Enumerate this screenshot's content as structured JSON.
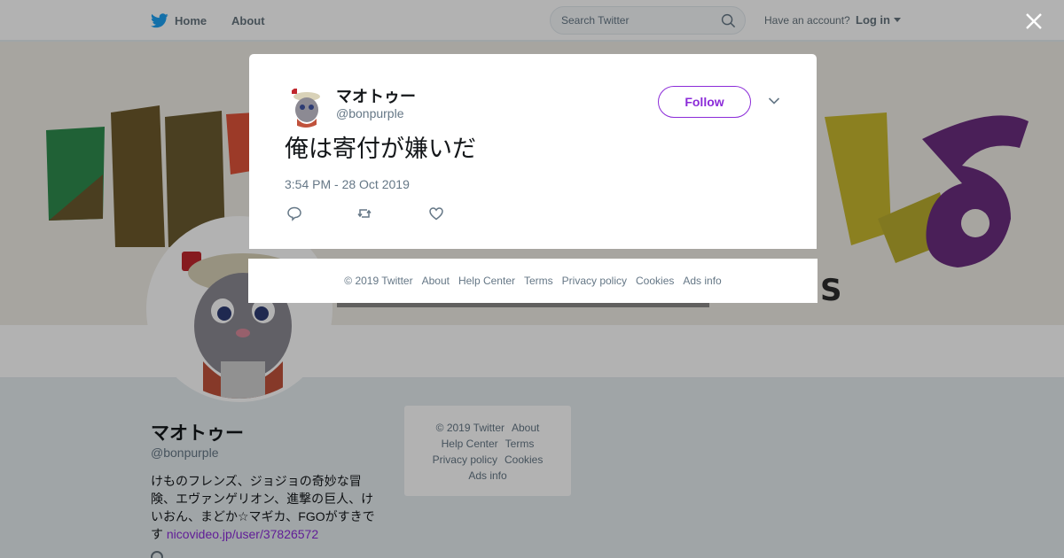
{
  "nav": {
    "home_label": "Home",
    "about_label": "About",
    "search_placeholder": "Search Twitter",
    "account_question": "Have an account?",
    "login_label": "Log in"
  },
  "profile": {
    "name": "マオトゥー",
    "handle": "@bonpurple",
    "bio": "けものフレンズ、ジョジョの奇妙な冒険、エヴァンゲリオン、進撃の巨人、けいおん、まどか☆マギカ、FGOがすきです",
    "link": "nicovideo.jp/user/37826572"
  },
  "side_footer": {
    "copyright": "© 2019 Twitter",
    "about": "About",
    "help": "Help Center",
    "terms": "Terms",
    "privacy": "Privacy policy",
    "cookies": "Cookies",
    "ads": "Ads info"
  },
  "tweet": {
    "name": "マオトゥー",
    "handle": "@bonpurple",
    "follow_label": "Follow",
    "text": "俺は寄付が嫌いだ",
    "time": "3:54 PM - 28 Oct 2019"
  },
  "modal_footer": {
    "copyright": "© 2019 Twitter",
    "about": "About",
    "help": "Help Center",
    "terms": "Terms",
    "privacy": "Privacy policy",
    "cookies": "Cookies",
    "ads": "Ads info"
  },
  "colors": {
    "accent": "#8b2bd8",
    "twitter_blue": "#1da1f2",
    "text_muted": "#657786"
  },
  "icons": [
    "twitter-bird-icon",
    "search-icon",
    "caret-down-icon",
    "close-icon",
    "chevron-down-icon",
    "reply-icon",
    "retweet-icon",
    "like-icon"
  ]
}
